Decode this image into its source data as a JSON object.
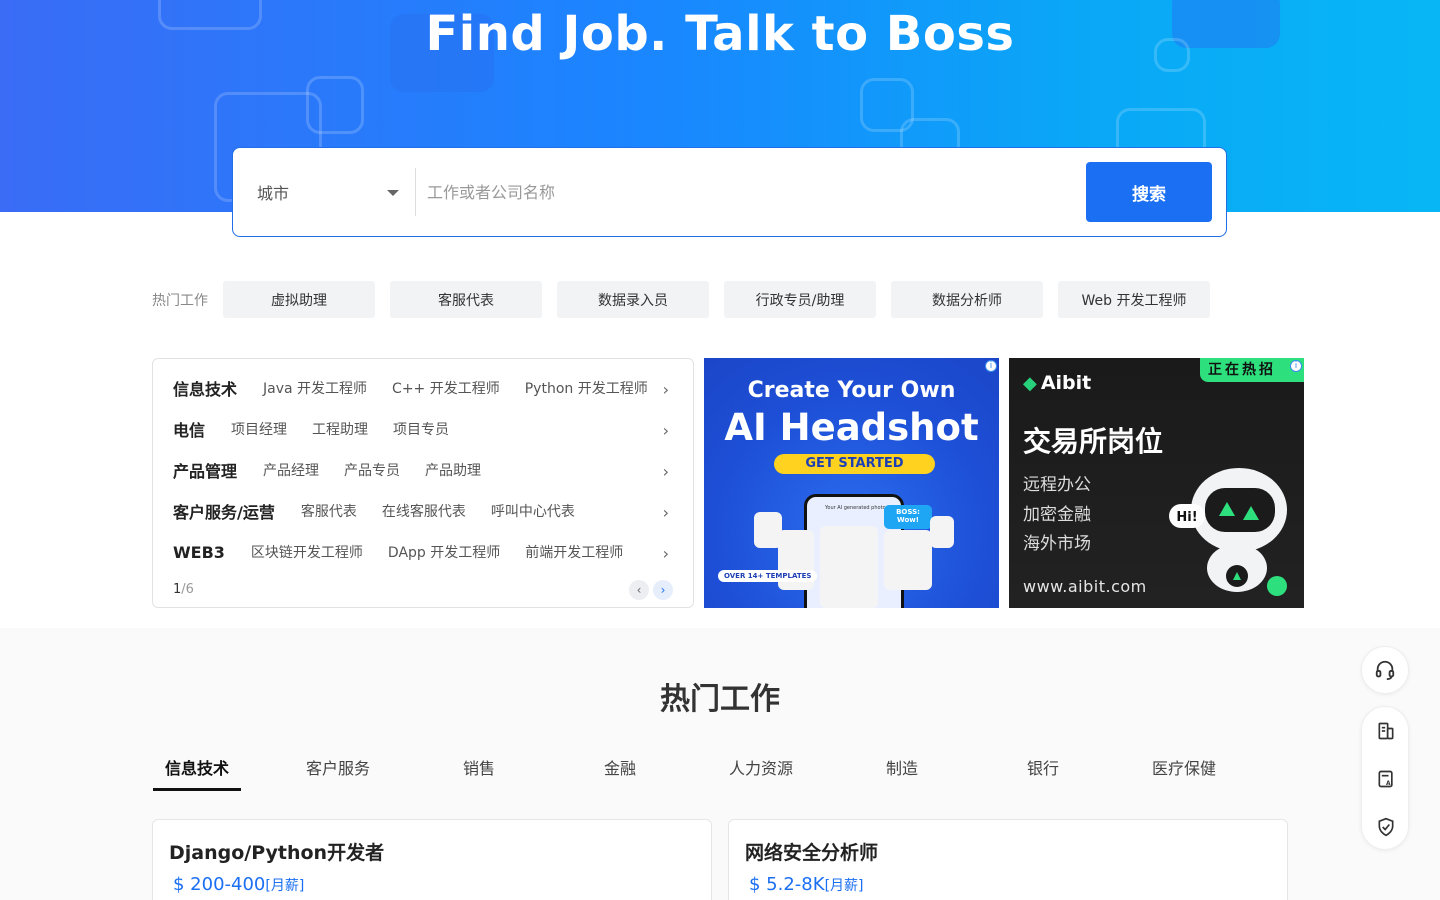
{
  "hero": {
    "title": "Find Job. Talk to Boss"
  },
  "search": {
    "city_label": "城市",
    "keyword_placeholder": "工作或者公司名称",
    "button_label": "搜索"
  },
  "hot_jobs": {
    "label": "热门工作",
    "tags": [
      "虚拟助理",
      "客服代表",
      "数据录入员",
      "行政专员/助理",
      "数据分析师",
      "Web 开发工程师"
    ]
  },
  "categories": {
    "rows": [
      {
        "name": "信息技术",
        "items": [
          "Java 开发工程师",
          "C++ 开发工程师",
          "Python 开发工程师"
        ]
      },
      {
        "name": "电信",
        "items": [
          "项目经理",
          "工程助理",
          "项目专员"
        ]
      },
      {
        "name": "产品管理",
        "items": [
          "产品经理",
          "产品专员",
          "产品助理"
        ]
      },
      {
        "name": "客户服务/运营",
        "items": [
          "客服代表",
          "在线客服代表",
          "呼叫中心代表"
        ]
      },
      {
        "name": "WEB3",
        "items": [
          "区块链开发工程师",
          "DApp 开发工程师",
          "前端开发工程师"
        ]
      }
    ],
    "page_current": "1",
    "page_total": "/6"
  },
  "ads": {
    "headshot": {
      "line1": "Create Your Own",
      "line2": "AI Headshot",
      "cta": "GET STARTED",
      "badge": "OVER 14+ TEMPLATES",
      "phone_caption": "Your AI generated photo",
      "bubble": "BOSS: Wow!"
    },
    "aibit": {
      "brand": "Aibit",
      "hot_tag": "正在热招",
      "title": "交易所岗位",
      "lines": [
        "远程办公",
        "加密金融",
        "海外市场"
      ],
      "bubble": "Hi!",
      "url": "www.aibit.com"
    }
  },
  "popular": {
    "title": "热门工作",
    "tabs": [
      "信息技术",
      "客户服务",
      "销售",
      "金融",
      "人力资源",
      "制造",
      "银行",
      "医疗保健"
    ],
    "active_tab": 0,
    "jobs": [
      {
        "title": "Django/Python开发者",
        "salary": "$ 200-400",
        "unit": "[月薪]"
      },
      {
        "title": "网络安全分析师",
        "salary": "$ 5.2-8K",
        "unit": "[月薪]"
      }
    ]
  },
  "colors": {
    "primary": "#1b6ff2",
    "hero_start": "#3a6cf6",
    "hero_end": "#08b6f5",
    "aibit_green": "#2ee07d"
  },
  "icons": [
    "headset-icon",
    "building-icon",
    "ai-resume-icon",
    "shield-check-icon",
    "chevron-right-icon",
    "caret-down-icon"
  ]
}
